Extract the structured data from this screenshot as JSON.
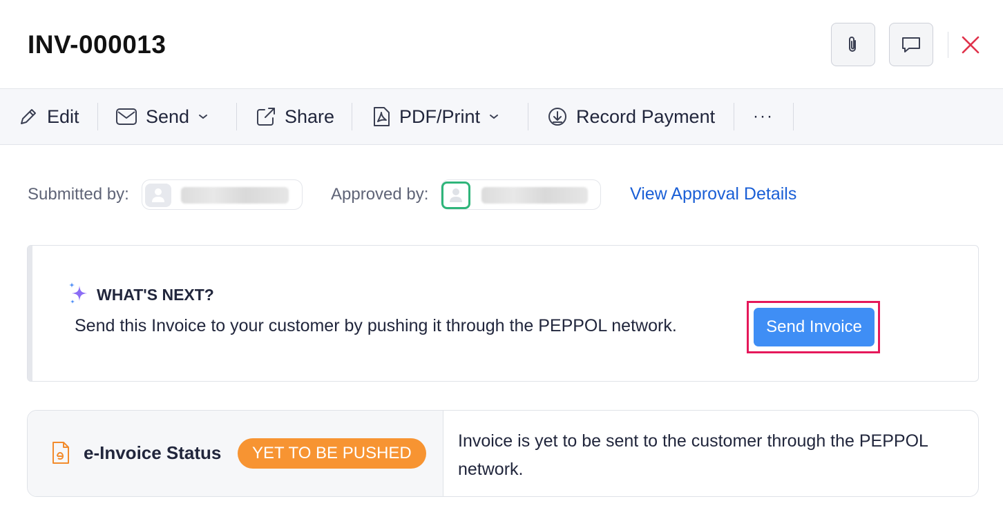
{
  "header": {
    "title": "INV-000013",
    "attach_icon": "paperclip-icon",
    "comment_icon": "comment-icon",
    "close_icon": "close-icon"
  },
  "toolbar": {
    "edit": "Edit",
    "send": "Send",
    "share": "Share",
    "pdf_print": "PDF/Print",
    "record_payment": "Record Payment",
    "more": "···"
  },
  "approval": {
    "submitted_label": "Submitted by:",
    "approved_label": "Approved by:",
    "view_details": "View Approval Details"
  },
  "whats_next": {
    "title": "WHAT'S NEXT?",
    "message": "Send this Invoice to your customer by pushing it through the PEPPOL network.",
    "button": "Send Invoice"
  },
  "einvoice": {
    "label": "e-Invoice Status",
    "badge": "YET TO BE PUSHED",
    "description": "Invoice is yet to be sent to the customer through the PEPPOL network."
  },
  "colors": {
    "primary": "#3f8ef5",
    "link": "#1a5fd6",
    "badge": "#f79432",
    "close": "#e0324b",
    "highlight": "#e5185a",
    "approved_ring": "#2fb57a"
  }
}
